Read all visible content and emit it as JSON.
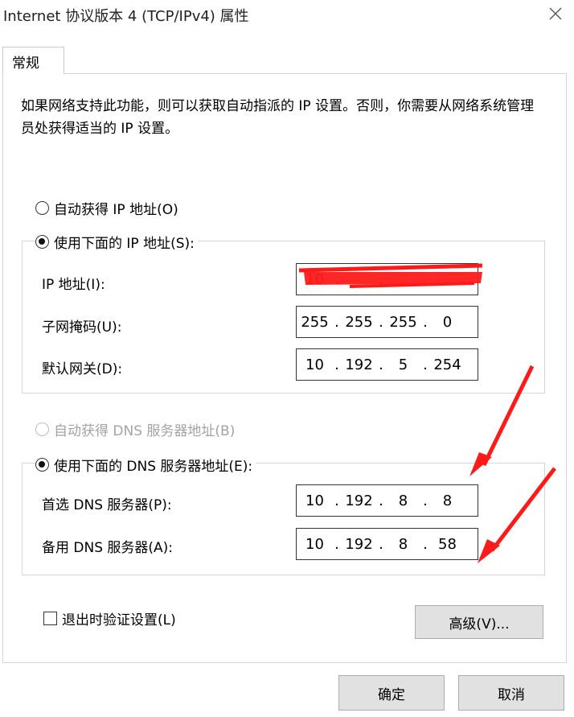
{
  "window": {
    "title": "Internet 协议版本 4 (TCP/IPv4) 属性"
  },
  "tabs": [
    {
      "label": "常规"
    }
  ],
  "description": "如果网络支持此功能，则可以获取自动指派的 IP 设置。否则，你需要从网络系统管理员处获得适当的 IP 设置。",
  "ip": {
    "auto_label": "自动获得 IP 地址(O)",
    "manual_label": "使用下面的 IP 地址(S):",
    "selected": "manual",
    "address": {
      "label": "IP 地址(I):",
      "octets": [
        "10",
        "",
        "",
        ""
      ]
    },
    "subnet": {
      "label": "子网掩码(U):",
      "octets": [
        "255",
        "255",
        "255",
        "0"
      ]
    },
    "gateway": {
      "label": "默认网关(D):",
      "octets": [
        "10",
        "192",
        "5",
        "254"
      ]
    }
  },
  "dns": {
    "auto_label": "自动获得 DNS 服务器地址(B)",
    "manual_label": "使用下面的 DNS 服务器地址(E):",
    "selected": "manual",
    "preferred": {
      "label": "首选 DNS 服务器(P):",
      "octets": [
        "10",
        "192",
        "8",
        "8"
      ]
    },
    "alternate": {
      "label": "备用 DNS 服务器(A):",
      "octets": [
        "10",
        "192",
        "8",
        "58"
      ]
    }
  },
  "validate_on_exit": {
    "label": "退出时验证设置(L)",
    "checked": false
  },
  "buttons": {
    "advanced": "高级(V)...",
    "ok": "确定",
    "cancel": "取消"
  },
  "colors": {
    "annotation": "#ff1a1a",
    "button_bg": "#e1e1e1"
  }
}
